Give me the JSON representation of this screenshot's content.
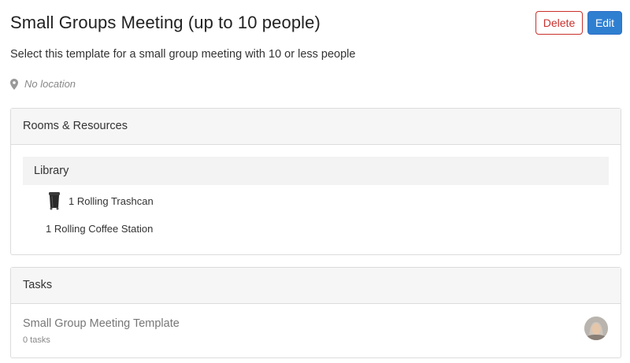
{
  "header": {
    "title": "Small Groups Meeting (up to 10 people)",
    "delete_label": "Delete",
    "edit_label": "Edit"
  },
  "description": "Select this template for a small group meeting with 10 or less people",
  "location": "No location",
  "rooms_panel": {
    "heading": "Rooms & Resources",
    "rooms": [
      {
        "name": "Library",
        "resources": [
          {
            "label": "1 Rolling Trashcan",
            "icon": "trashcan-icon"
          },
          {
            "label": "1 Rolling Coffee Station"
          }
        ]
      }
    ]
  },
  "tasks_panel": {
    "heading": "Tasks",
    "items": [
      {
        "name": "Small Group Meeting Template",
        "count": "0 tasks",
        "icon": "user-avatar"
      }
    ]
  },
  "colors": {
    "delete": "#c9302c",
    "edit": "#2f7fd1",
    "panel_heading_bg": "#f6f6f6",
    "room_bar_bg": "#f3f3f3"
  }
}
